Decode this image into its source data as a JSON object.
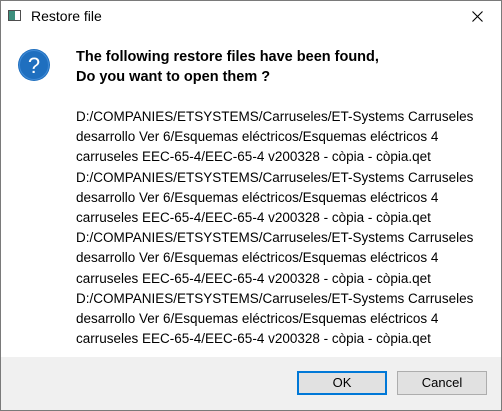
{
  "window": {
    "title": "Restore file"
  },
  "message": {
    "line1": "The following restore files have been found,",
    "line2": "Do you want to open them ?"
  },
  "files": [
    {
      "line1": "D:/COMPANIES/ETSYSTEMS/Carruseles/ET-Systems Carruseles",
      "line2": "desarrollo Ver 6/Esquemas eléctricos/Esquemas eléctricos 4",
      "line3": "carruseles EEC-65-4/EEC-65-4 v200328 - còpia - còpia.qet"
    },
    {
      "line1": "D:/COMPANIES/ETSYSTEMS/Carruseles/ET-Systems Carruseles",
      "line2": "desarrollo Ver 6/Esquemas eléctricos/Esquemas eléctricos 4",
      "line3": "carruseles EEC-65-4/EEC-65-4 v200328 - còpia - còpia.qet"
    },
    {
      "line1": "D:/COMPANIES/ETSYSTEMS/Carruseles/ET-Systems Carruseles",
      "line2": "desarrollo Ver 6/Esquemas eléctricos/Esquemas eléctricos 4",
      "line3": "carruseles EEC-65-4/EEC-65-4 v200328 - còpia - còpia.qet"
    },
    {
      "line1": "D:/COMPANIES/ETSYSTEMS/Carruseles/ET-Systems Carruseles",
      "line2": "desarrollo Ver 6/Esquemas eléctricos/Esquemas eléctricos 4",
      "line3": "carruseles EEC-65-4/EEC-65-4 v200328 - còpia - còpia.qet"
    }
  ],
  "buttons": {
    "ok_label": "OK",
    "cancel_label": "Cancel"
  },
  "colors": {
    "accent": "#0078d7",
    "question_icon": "#1f6fbf",
    "footer_bg": "#f0f0f0"
  },
  "icons": {
    "app": "app-icon",
    "close": "close-icon",
    "question": "question-icon"
  }
}
